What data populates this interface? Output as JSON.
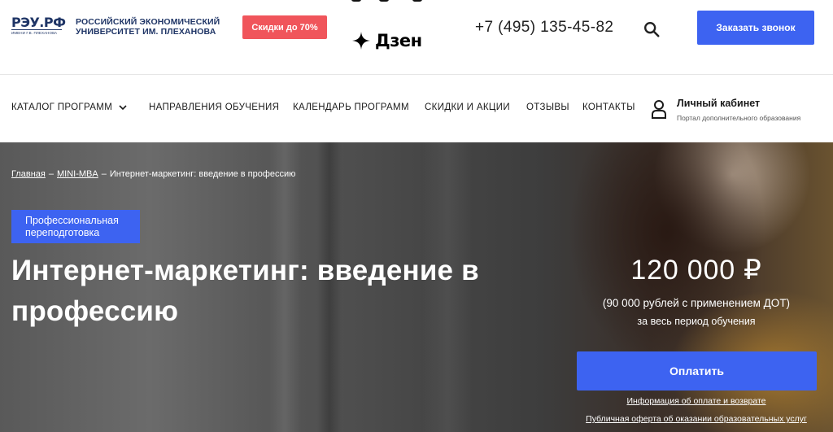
{
  "header": {
    "logo_main": "РЭУ.РФ",
    "logo_sub": "ИМЕНИ Г.В. ПЛЕХАНОВА",
    "university_line1": "РОССИЙСКИЙ ЭКОНОМИЧЕСКИЙ",
    "university_line2": "УНИВЕРСИТЕТ ИМ. ПЛЕХАНОВА",
    "discount_badge": "Скидки до 70%",
    "dzen_label": "Дзен",
    "phone": "+7 (495) 135-45-82",
    "callback_button": "Заказать звонок",
    "icons": [
      "search-icon",
      "dzen-star-icon"
    ]
  },
  "nav": {
    "items": [
      {
        "label": "КАТАЛОГ ПРОГРАММ"
      },
      {
        "label": "НАПРАВЛЕНИЯ ОБУЧЕНИЯ"
      },
      {
        "label": "КАЛЕНДАРЬ ПРОГРАММ"
      },
      {
        "label": "СКИДКИ И АКЦИИ"
      },
      {
        "label": "ОТЗЫВЫ"
      },
      {
        "label": "КОНТАКТЫ"
      }
    ],
    "cabinet_title": "Личный кабинет",
    "cabinet_subtitle": "Портал дополнительного образования"
  },
  "hero": {
    "breadcrumb": {
      "home": "Главная",
      "section": "MINI-MBA",
      "current": "Интернет-маркетинг: введение в профессию",
      "separator": "–"
    },
    "badge": "Профессиональная переподготовка",
    "title": "Интернет-маркетинг: введение в профессию",
    "price": "120 000 ₽",
    "price_note": "(90 000 рублей с применением ДОТ)",
    "price_period": "за весь период обучения",
    "pay_button": "Оплатить",
    "link_payment": "Информация об оплате и возврате",
    "link_offer": "Публичная оферта об оказании образовательных услуг"
  },
  "colors": {
    "accent": "#3d63f1",
    "discount": "#f0555b",
    "brand_navy": "#1f3566"
  }
}
